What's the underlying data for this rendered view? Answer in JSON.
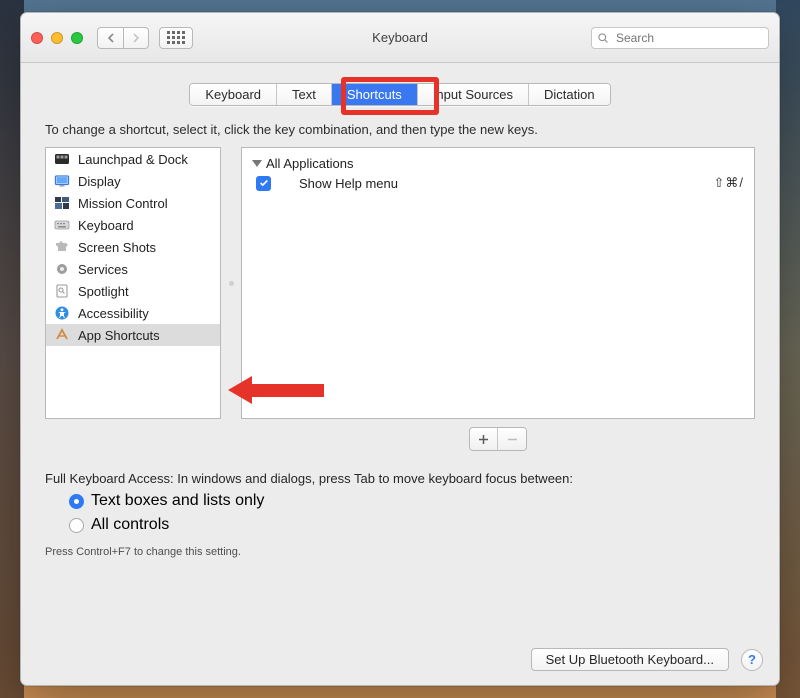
{
  "window": {
    "title": "Keyboard"
  },
  "search": {
    "placeholder": "Search"
  },
  "tabs": {
    "items": [
      "Keyboard",
      "Text",
      "Shortcuts",
      "Input Sources",
      "Dictation"
    ],
    "active_index": 2
  },
  "instruction": "To change a shortcut, select it, click the key combination, and then type the new keys.",
  "categories": {
    "items": [
      {
        "label": "Launchpad & Dock",
        "icon": "launchpad"
      },
      {
        "label": "Display",
        "icon": "display"
      },
      {
        "label": "Mission Control",
        "icon": "mission"
      },
      {
        "label": "Keyboard",
        "icon": "keyboard"
      },
      {
        "label": "Screen Shots",
        "icon": "screenshots"
      },
      {
        "label": "Services",
        "icon": "gear"
      },
      {
        "label": "Spotlight",
        "icon": "spotlight"
      },
      {
        "label": "Accessibility",
        "icon": "accessibility"
      },
      {
        "label": "App Shortcuts",
        "icon": "appshortcuts"
      }
    ],
    "selected_index": 8
  },
  "detail": {
    "group_label": "All Applications",
    "items": [
      {
        "checked": true,
        "label": "Show Help menu",
        "shortcut": "⇧⌘/"
      }
    ]
  },
  "fka": {
    "heading": "Full Keyboard Access: In windows and dialogs, press Tab to move keyboard focus between:",
    "options": [
      "Text boxes and lists only",
      "All controls"
    ],
    "selected_index": 0,
    "hint": "Press Control+F7 to change this setting."
  },
  "footer": {
    "bluetooth_button": "Set Up Bluetooth Keyboard..."
  }
}
